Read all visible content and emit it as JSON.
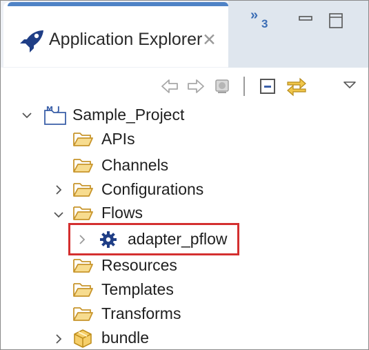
{
  "view": {
    "tab_title": "Application Explorer",
    "tab_close_glyph": "✕",
    "overflow_count": "3",
    "overflow_glyph": "»",
    "icons": {
      "tab": "rocket-icon",
      "overflow": "overflow-views-icon",
      "minimize": "minimize-icon",
      "maximize": "maximize-icon"
    },
    "colors": {
      "accent": "#4f83c6",
      "highlight_border": "#d42f2f",
      "folder": "#e8b94a"
    }
  },
  "toolbar": {
    "buttons": [
      {
        "name": "back-button",
        "icon": "arrow-left-icon"
      },
      {
        "name": "forward-button",
        "icon": "arrow-right-icon"
      },
      {
        "name": "home-button",
        "icon": "home-icon"
      },
      {
        "name": "collapse-all-button",
        "icon": "collapse-all-icon"
      },
      {
        "name": "link-editor-button",
        "icon": "link-with-editor-icon"
      },
      {
        "name": "view-menu-button",
        "icon": "view-menu-icon"
      }
    ]
  },
  "tree": {
    "project": {
      "label": "Sample_Project",
      "expanded": true,
      "icon": "project-icon"
    },
    "items": [
      {
        "label": "APIs",
        "icon": "folder-icon",
        "twisty": "none"
      },
      {
        "label": "Channels",
        "icon": "folder-icon",
        "twisty": "none"
      },
      {
        "label": "Configurations",
        "icon": "folder-icon",
        "twisty": "collapsed"
      },
      {
        "label": "Flows",
        "icon": "folder-icon",
        "twisty": "expanded"
      },
      {
        "label": "adapter_pflow",
        "icon": "gear-icon",
        "twisty": "collapsed",
        "highlighted": true
      },
      {
        "label": "Resources",
        "icon": "folder-icon",
        "twisty": "none"
      },
      {
        "label": "Templates",
        "icon": "folder-icon",
        "twisty": "none"
      },
      {
        "label": "Transforms",
        "icon": "folder-icon",
        "twisty": "none"
      },
      {
        "label": "bundle",
        "icon": "bundle-icon",
        "twisty": "collapsed"
      }
    ]
  }
}
